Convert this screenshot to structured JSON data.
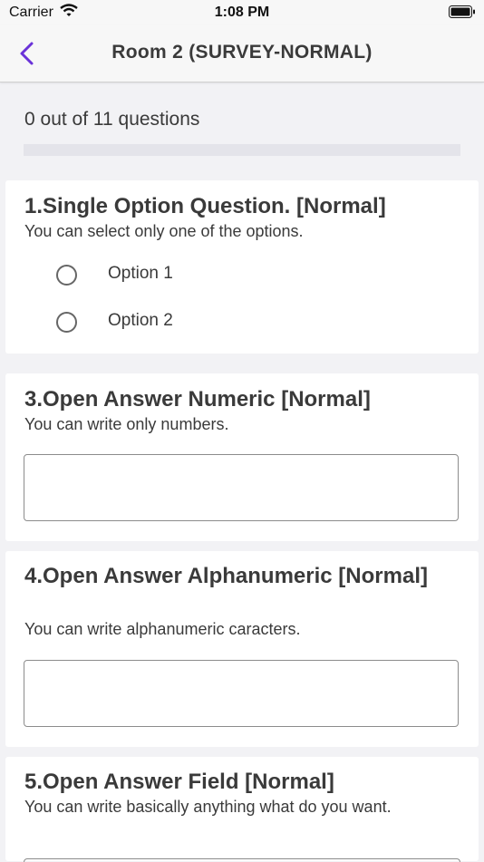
{
  "status_bar": {
    "carrier": "Carrier",
    "time": "1:08 PM"
  },
  "nav": {
    "title": "Room 2 (SURVEY-NORMAL)"
  },
  "progress": {
    "label": "0 out of 11 questions",
    "fraction": 0
  },
  "questions": [
    {
      "title": "1.Single Option Question. [Normal]",
      "description": "You can select only one of the options.",
      "options": [
        "Option 1",
        "Option 2"
      ]
    },
    {
      "title": "3.Open Answer Numeric [Normal]",
      "description": "You can write only numbers.",
      "value": ""
    },
    {
      "title": "4.Open Answer Alphanumeric [Normal]",
      "description": "You can write alphanumeric caracters.",
      "value": ""
    },
    {
      "title": "5.Open Answer Field [Normal]",
      "description": "You can write basically anything what do you want."
    }
  ],
  "colors": {
    "accent": "#7b3fe4",
    "background": "#f2f2f5",
    "card": "#ffffff"
  }
}
